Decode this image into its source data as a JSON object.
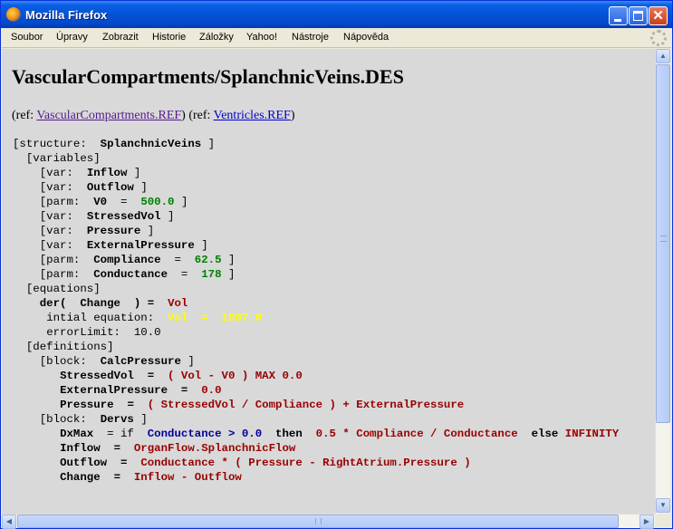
{
  "window": {
    "title": "Mozilla Firefox",
    "accent_color": "#0553d8"
  },
  "menu": {
    "items": [
      "Soubor",
      "Úpravy",
      "Zobrazit",
      "Historie",
      "Záložky",
      "Yahoo!",
      "Nástroje",
      "Nápověda"
    ]
  },
  "page": {
    "title": "VascularCompartments/SplanchnicVeins.DES",
    "ref_open_1": "(ref: ",
    "ref_link_1": "VascularCompartments.REF",
    "ref_close_1": ") (ref: ",
    "ref_link_2": "Ventricles.REF",
    "ref_close_2": ")"
  },
  "code": {
    "structure_open": "[structure:",
    "structure_name": "SplanchnicVeins",
    "variables": "[variables]",
    "var_tag": "[var:",
    "parm_tag": "[parm:",
    "close": "]",
    "var_inflow": "Inflow",
    "var_outflow": "Outflow",
    "parm_v0": "V0",
    "parm_v0_val": "500.0",
    "var_stressedvol": "StressedVol",
    "var_pressure": "Pressure",
    "var_extpressure": "ExternalPressure",
    "parm_compliance": "Compliance",
    "parm_compliance_val": "62.5",
    "parm_conductance": "Conductance",
    "parm_conductance_val": "178",
    "equations": "[equations]",
    "der": "der(",
    "der_change": "Change",
    "der_close": ") =",
    "der_vol": "Vol",
    "initial_label": "intial equation:",
    "initial_expr": "Vol  =  1007.0",
    "error_limit": "errorLimit:  10.0",
    "definitions": "[definitions]",
    "block_tag": "[block:",
    "block_calc": "CalcPressure",
    "def_stressedvol": "StressedVol",
    "def_stressedvol_expr": "( Vol - V0 ) MAX 0.0",
    "def_extpressure": "ExternalPressure",
    "def_extpressure_val": "0.0",
    "def_pressure": "Pressure",
    "def_pressure_expr": "( StressedVol / Compliance ) + ExternalPressure",
    "block_derivs": "Dervs",
    "dxmax": "DxMax",
    "dxmax_if": "= if",
    "dxmax_cond": "Conductance > 0.0",
    "dxmax_then": "then",
    "dxmax_expr": "0.5 * Compliance / Conductance",
    "dxmax_else": "else",
    "dxmax_inf": "INFINITY",
    "def_inflow": "Inflow",
    "def_inflow_expr": "OrganFlow.SplanchnicFlow",
    "def_outflow": "Outflow",
    "def_outflow_expr": "Conductance * ( Pressure - RightAtrium.Pressure )",
    "def_change": "Change",
    "def_change_expr": "Inflow - Outflow",
    "eq": "="
  }
}
